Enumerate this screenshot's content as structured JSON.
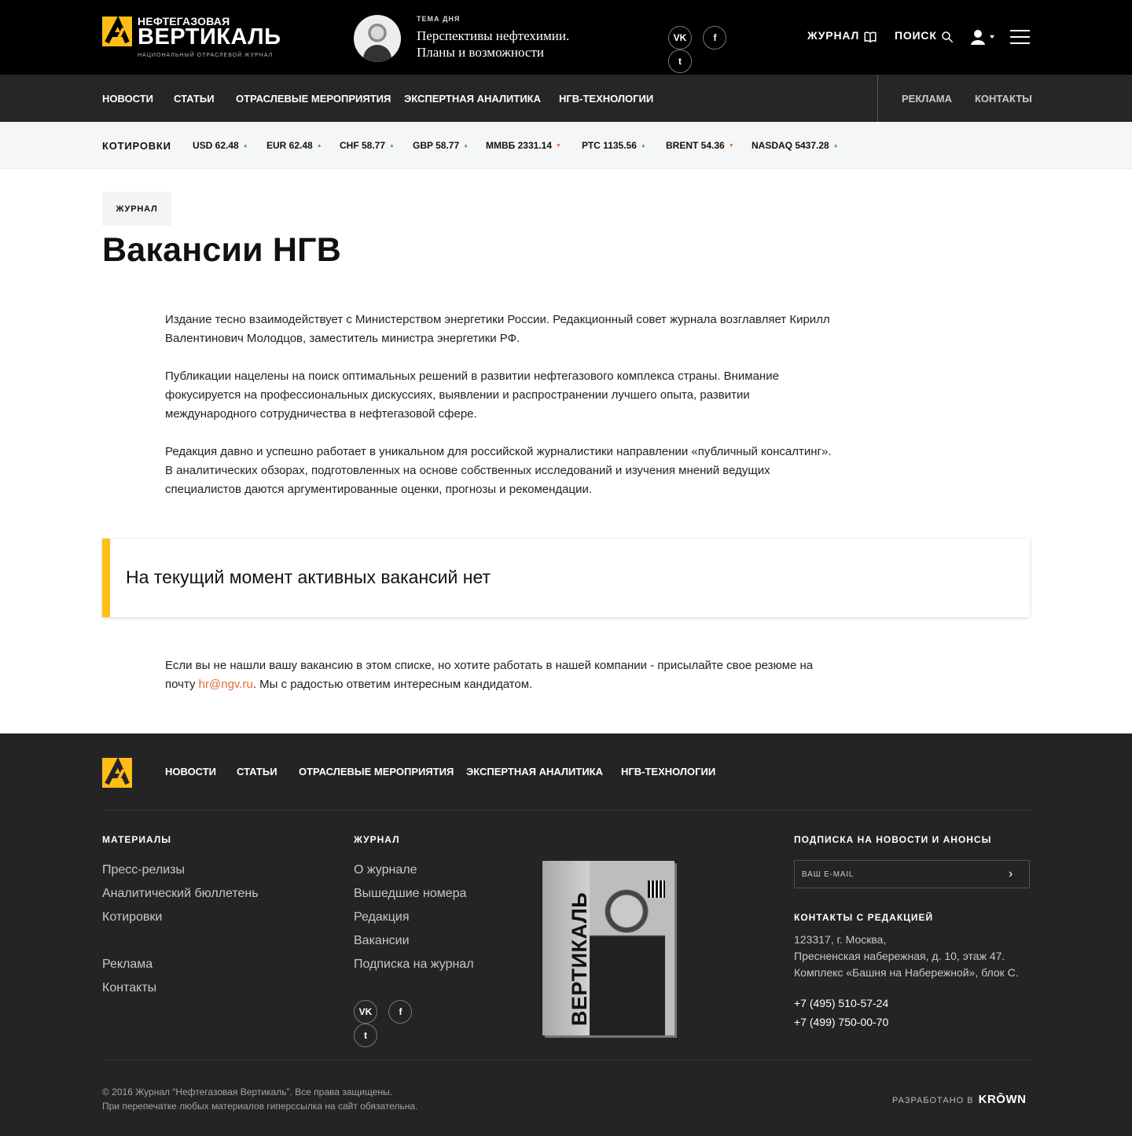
{
  "header": {
    "logo": {
      "top": "НЕФТЕГАЗОВАЯ",
      "main": "ВЕРТИКАЛЬ",
      "sub": "НАЦИОНАЛЬНЫЙ ОТРАСЛЕВОЙ ЖУРНАЛ"
    },
    "topic": {
      "label": "ТЕМА ДНЯ",
      "text": "Перспективы нефтехимии. Планы и возможности"
    },
    "social": [
      {
        "icon": "vk-icon",
        "label": "VK"
      },
      {
        "icon": "facebook-icon",
        "label": "f"
      },
      {
        "icon": "twitter-icon",
        "label": "t"
      }
    ],
    "journal_label": "ЖУРНАЛ",
    "search_label": "ПОИСК",
    "icons": {
      "journal": "book-icon",
      "search": "search-icon",
      "user": "user-icon",
      "menu": "menu-icon"
    }
  },
  "nav": {
    "items": [
      "НОВОСТИ",
      "СТАТЬИ",
      "ОТРАСЛЕВЫЕ МЕРОПРИЯТИЯ",
      "ЭКСПЕРТНАЯ АНАЛИТИКА",
      "НГВ-ТЕХНОЛОГИИ"
    ],
    "right": [
      "РЕКЛАМА",
      "КОНТАКТЫ"
    ]
  },
  "quotes": {
    "title": "КОТИРОВКИ",
    "items": [
      {
        "label": "USD 62.48",
        "trend": "up"
      },
      {
        "label": "EUR 62.48",
        "trend": "up"
      },
      {
        "label": "CHF 58.77",
        "trend": "up"
      },
      {
        "label": "GBP 58.77",
        "trend": "up"
      },
      {
        "label": "ММВБ 2331.14",
        "trend": "down"
      },
      {
        "label": "РТС 1135.56",
        "trend": "up"
      },
      {
        "label": "BRENT 54.36",
        "trend": "down"
      },
      {
        "label": "NASDAQ 5437.28",
        "trend": "up"
      }
    ]
  },
  "main": {
    "badge": "ЖУРНАЛ",
    "title": "Вакансии НГВ",
    "paragraphs": [
      "Издание тесно взаимодействует с Министерством энергетики России. Редакционный совет журнала возглавляет Кирилл Валентинович Молодцов, заместитель министра энергетики РФ.",
      "Публикации нацелены на поиск оптимальных решений в развитии нефтегазового комплекса страны. Внимание фокусируется на профессиональных дискуссиях, выявлении и распространении лучшего опыта, развитии международного сотрудничества в нефтегазовой сфере.",
      "Редакция давно и успешно работает в уникальном для российской журналистики направлении «публичный консалтинг». В аналитических обзорах, подготовленных на основе собственных исследований и изучения мнений ведущих специалистов даются аргументированные оценки, прогнозы и рекомендации."
    ],
    "notice": "На текущий момент активных вакансий нет",
    "contact_before": "Если вы не нашли вашу вакансию в этом списке, но хотите работать в нашей компании - присылайте свое резюме на почту ",
    "contact_email": "hr@ngv.ru",
    "contact_after": ". Мы с радостью ответим интересным кандидатом."
  },
  "footer": {
    "nav": [
      "НОВОСТИ",
      "СТАТЬИ",
      "ОТРАСЛЕВЫЕ МЕРОПРИЯТИЯ",
      "ЭКСПЕРТНАЯ АНАЛИТИКА",
      "НГВ-ТЕХНОЛОГИИ"
    ],
    "materials": {
      "title": "МАТЕРИАЛЫ",
      "links": [
        "Пресс-релизы",
        "Аналитический бюллетень",
        "Котировки",
        "Реклама",
        "Контакты"
      ]
    },
    "journal": {
      "title": "ЖУРНАЛ",
      "links": [
        "О журнале",
        "Вышедшие номера",
        "Редакция",
        "Вакансии",
        "Подписка на журнал"
      ]
    },
    "subscription": {
      "title": "ПОДПИСКА НА НОВОСТИ И АНОНСЫ",
      "placeholder": "ВАШ E-MAIL"
    },
    "contacts": {
      "title": "КОНТАКТЫ С РЕДАКЦИЕЙ",
      "address": "123317, г. Москва,\nПресненская набережная, д. 10, этаж 47.\nКомплекс «Башня на Набережной», блок С.",
      "phones": [
        "+7 (495) 510-57-24",
        "+7 (499) 750-00-70"
      ]
    },
    "cover_title": "ВЕРТИКАЛЬ",
    "copyright": "© 2016 Журнал “Нефтегазовая Вертикаль”. Все права защищены.\nПри перепечатке любых материалов гиперссылка на сайт обязательна.",
    "developer_prefix": "РАЗРАБОТАНО В",
    "developer_name": "KRŌWN"
  },
  "colors": {
    "accent": "#ffbd18",
    "header": "#000000",
    "nav": "#262626",
    "footer": "#242424",
    "up": "#5e9f72",
    "down": "#e16d38"
  }
}
